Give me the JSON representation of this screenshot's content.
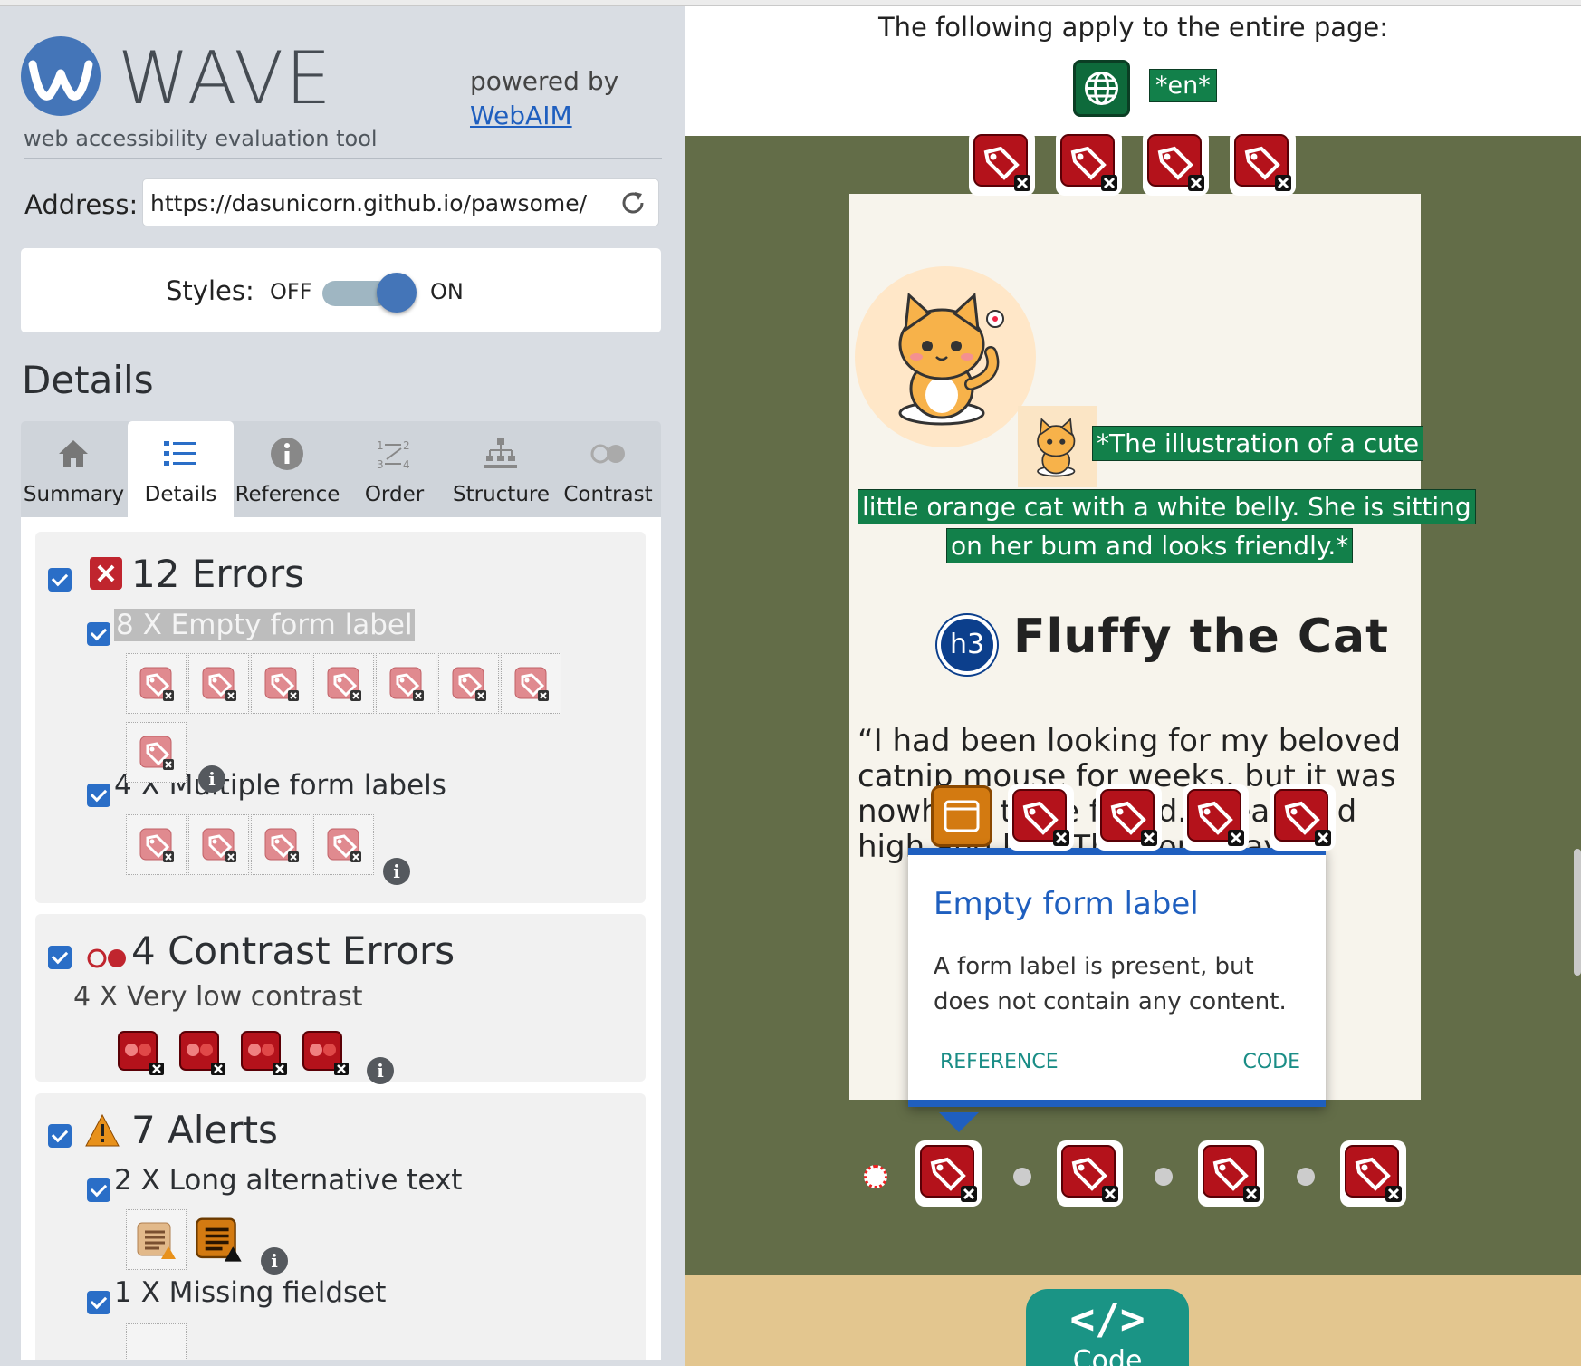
{
  "app": {
    "brand": "WAVE",
    "tagline": "web accessibility evaluation tool",
    "powered_by": "powered by",
    "powered_link": "WebAIM"
  },
  "address": {
    "label": "Address:",
    "value": "https://dasunicorn.github.io/pawsome/"
  },
  "styles": {
    "label": "Styles:",
    "off": "OFF",
    "on": "ON",
    "state": "on"
  },
  "details_title": "Details",
  "tabs": [
    {
      "label": "Summary",
      "icon": "home-icon"
    },
    {
      "label": "Details",
      "icon": "list-icon",
      "active": true
    },
    {
      "label": "Reference",
      "icon": "info-icon"
    },
    {
      "label": "Order",
      "icon": "order-icon"
    },
    {
      "label": "Structure",
      "icon": "structure-icon"
    },
    {
      "label": "Contrast",
      "icon": "contrast-icon"
    }
  ],
  "errors": {
    "title": "12 Errors",
    "items": [
      {
        "label": "8 X Empty form label",
        "count": 8
      },
      {
        "label": "4 X Multiple form labels",
        "count": 4
      }
    ]
  },
  "contrast": {
    "title": "4 Contrast Errors",
    "item": "4 X Very low contrast",
    "count": 4
  },
  "alerts": {
    "title": "7 Alerts",
    "items": [
      {
        "label": "2 X Long alternative text",
        "count": 2
      },
      {
        "label": "1 X Missing fieldset",
        "count": 1
      }
    ]
  },
  "page": {
    "entire_page_text": "The following apply to the entire page:",
    "lang_badge": "*en*",
    "alt_text_lines": [
      "*The illustration of a cute",
      "little orange cat with a white belly. She is sitting",
      "on her bum and looks friendly.*"
    ],
    "h3_badge": "h3",
    "heading": "Fluffy the Cat",
    "quote": "“I had been looking for my beloved catnip mouse for weeks, but it was nowhere to be found. I searched high and low. Then one day..."
  },
  "popup": {
    "title": "Empty form label",
    "body": "A form label is present, but does not contain any content.",
    "reference": "REFERENCE",
    "code": "CODE"
  },
  "code_button": {
    "icon": "</>",
    "label": "Code"
  },
  "colors": {
    "error_red": "#b4121b",
    "alert_orange": "#d37a11",
    "wave_blue": "#4475b8",
    "page_bg": "#636d48",
    "aim_green": "#12804a"
  }
}
